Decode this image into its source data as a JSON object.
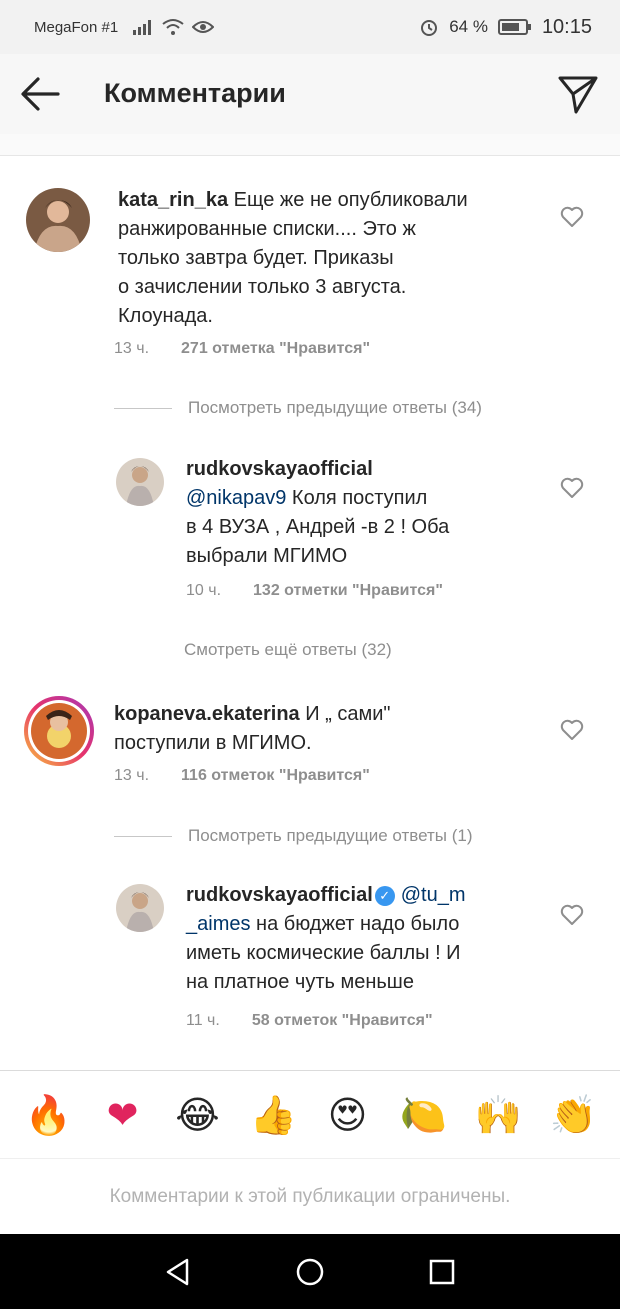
{
  "status_bar": {
    "carrier": "MegaFon #1",
    "battery": "64 %",
    "time": "10:15"
  },
  "header": {
    "title": "Комментарии",
    "back_icon": "arrow-left-icon",
    "dm_icon": "paper-plane-icon"
  },
  "comments": [
    {
      "username": "kata_rin_ka",
      "text_lines": [
        "Еще же не опубликовали",
        "ранжированные списки.... Это ж",
        "только завтра будет. Приказы",
        "о зачислении только 3 августа.",
        "Клоунада."
      ],
      "time": "13 ч.",
      "likes": "271 отметка \"Нравится\""
    },
    {
      "username": "rudkovskayaofficial",
      "mention": "@nikapav9",
      "text_lines": [
        " Коля поступил",
        "в 4 ВУЗА , Андрей -в 2 ! Оба",
        "выбрали МГИМО"
      ],
      "time": "10 ч.",
      "likes": "132 отметки \"Нравится\""
    },
    {
      "username": "kopaneva.ekaterina",
      "text_lines": [
        "И „ сами\"",
        "поступили в МГИМО."
      ],
      "time": "13 ч.",
      "likes": "116 отметок \"Нравится\""
    },
    {
      "username": "rudkovskayaofficial",
      "mention_a": "@tu_m",
      "mention_b": "_aimes",
      "text_lines": [
        " на бюджет надо было",
        "иметь космические баллы ! И",
        "на платное чуть меньше"
      ],
      "time": "11 ч.",
      "likes": "58 отметок \"Нравится\""
    }
  ],
  "threads": {
    "view_previous_1": "Посмотреть предыдущие ответы (34)",
    "see_more": "Смотреть ещё ответы (32)",
    "view_previous_2": "Посмотреть предыдущие ответы (1)"
  },
  "reactions": [
    "🔥",
    "❤",
    "😂",
    "👍",
    "😍",
    "🍋",
    "🙌",
    "👏"
  ],
  "restricted_text": "Комментарии к этой публикации ограничены.",
  "colors": {
    "accent": "#3897f0",
    "mention": "#003569",
    "muted": "#8e8e8e"
  }
}
